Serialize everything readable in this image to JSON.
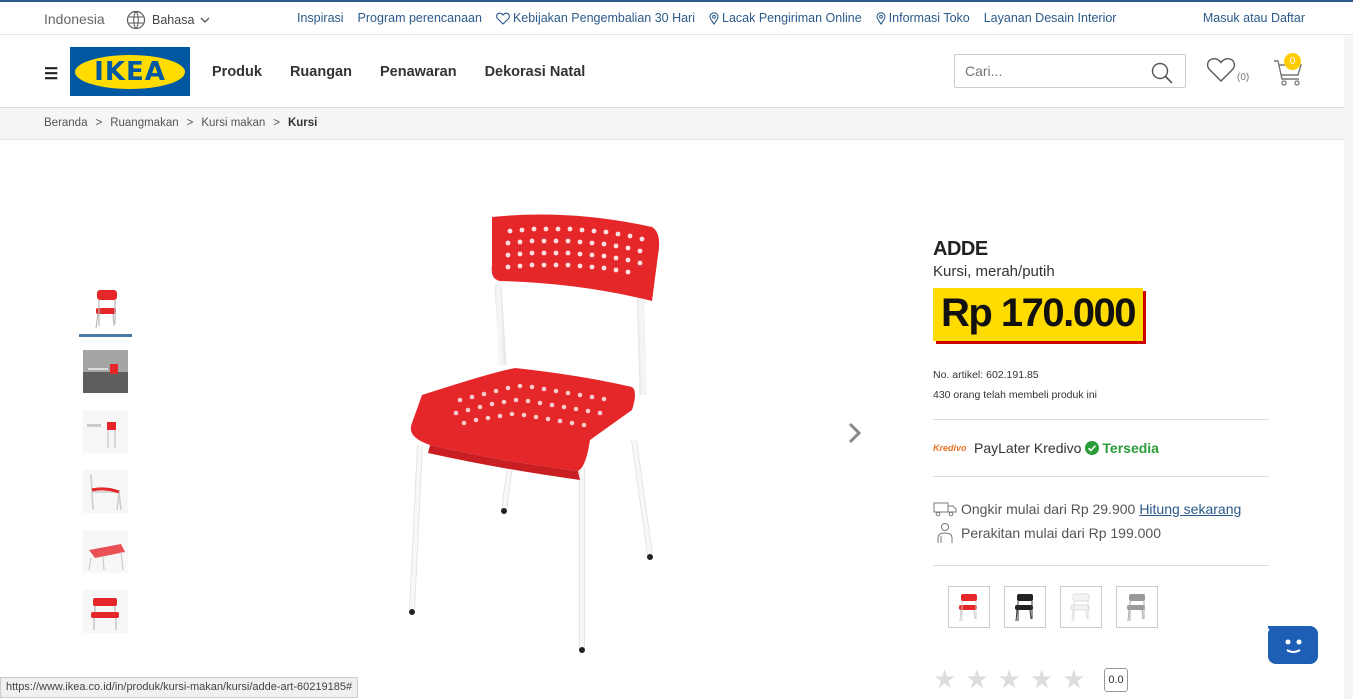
{
  "topbar": {
    "country": "Indonesia",
    "language": "Bahasa",
    "links": [
      {
        "label": "Inspirasi",
        "icon": ""
      },
      {
        "label": "Program perencanaan",
        "icon": ""
      },
      {
        "label": "Kebijakan Pengembalian 30 Hari",
        "icon": "heart-icon"
      },
      {
        "label": "Lacak Pengiriman Online",
        "icon": "location-pin-icon"
      },
      {
        "label": "Informasi Toko",
        "icon": "location-pin-icon"
      },
      {
        "label": "Layanan Desain Interior",
        "icon": ""
      }
    ],
    "login": "Masuk atau Daftar"
  },
  "header": {
    "logo_text": "IKEA",
    "nav": [
      "Produk",
      "Ruangan",
      "Penawaran",
      "Dekorasi Natal"
    ],
    "search_placeholder": "Cari...",
    "wishlist_count": "(0)",
    "cart_count": "0"
  },
  "breadcrumb": {
    "items": [
      "Beranda",
      "Ruangmakan",
      "Kursi makan",
      "Kursi"
    ],
    "separator": ">"
  },
  "product": {
    "name": "ADDE",
    "description": "Kursi, merah/putih",
    "price": "Rp 170.000",
    "article_no": "No. artikel: 602.191.85",
    "bought_count": "430 orang telah membeli produk ini",
    "kredivo_logo": "Kredivo",
    "kredivo_label": "PayLater Kredivo",
    "kredivo_status": "Tersedia",
    "shipping_text": "Ongkir mulai dari Rp 29.900",
    "shipping_link": "Hitung sekarang",
    "assembly_text": "Perakitan mulai dari Rp 199.000",
    "rating": "0.0",
    "color_variants": [
      "red",
      "black",
      "white",
      "grey"
    ]
  },
  "colors": {
    "ikea_blue": "#0058a3",
    "ikea_yellow": "#ffdb00",
    "link_blue": "#2b5a8a",
    "chair_red": "#e5272a",
    "available_green": "#2a9d3a"
  },
  "status_url": "https://www.ikea.co.id/in/produk/kursi-makan/kursi/adde-art-60219185#"
}
